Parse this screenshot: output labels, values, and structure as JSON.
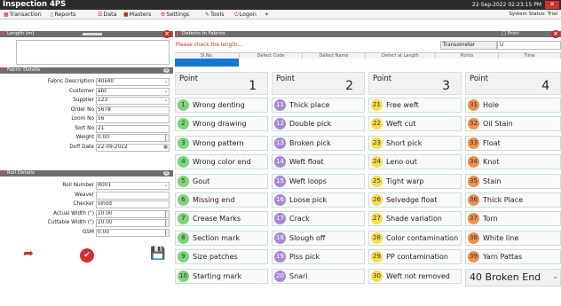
{
  "app": {
    "title": "Inspection 4PS",
    "datetime": "22-Sep-2022 02:23:15 PM",
    "system_status": "System Status: Trial"
  },
  "menu": [
    {
      "icon": "▦",
      "label": "Transaction",
      "color": "#c62828"
    },
    {
      "icon": "▯",
      "label": "Reports",
      "color": "#666"
    },
    {
      "icon": "☰",
      "label": "Data",
      "color": "#c62828"
    },
    {
      "icon": "■",
      "label": "Masters",
      "color": "#c62828"
    },
    {
      "icon": "⚙",
      "label": "Settings",
      "color": "#c62828"
    },
    {
      "icon": "✎",
      "label": "Tools",
      "color": "#555"
    },
    {
      "icon": "⏻",
      "label": "Logon",
      "color": "#c62828"
    },
    {
      "icon": "✦",
      "label": "",
      "color": "#c62828"
    }
  ],
  "panels": {
    "length": "Length (m)",
    "fabric": "Fabric Details",
    "roll": "Roll Details",
    "defects": "Defects In Fabrics"
  },
  "fabric_fields": [
    {
      "label": "Fabric Description",
      "value": "40x40",
      "type": "dd"
    },
    {
      "label": "Customer",
      "value": "abc",
      "type": "dd"
    },
    {
      "label": "Supplier",
      "value": "123",
      "type": "dd"
    },
    {
      "label": "Order No",
      "value": "5678",
      "type": "text"
    },
    {
      "label": "Loom No",
      "value": "56",
      "type": "text"
    },
    {
      "label": "Sort No",
      "value": "21",
      "type": "text"
    },
    {
      "label": "Weight",
      "value": "0.00",
      "type": "spin"
    },
    {
      "label": "Doff Date",
      "value": "22-09-2022",
      "type": "cal"
    }
  ],
  "roll_fields": [
    {
      "label": "Roll Number",
      "value": "R001",
      "type": "dd"
    },
    {
      "label": "Weaver",
      "value": "",
      "type": "text"
    },
    {
      "label": "Checker",
      "value": "vinod",
      "type": "text"
    },
    {
      "label": "Actual Width (\")",
      "value": "10.00",
      "type": "spin"
    },
    {
      "label": "Cuttable Width (\")",
      "value": "10.00",
      "type": "spin"
    },
    {
      "label": "GSM",
      "value": "0.00",
      "type": "spin"
    }
  ],
  "defects": {
    "warning": "Please check the length...",
    "transometer_label": "Transometer",
    "transometer_value": "U",
    "print_label": "Print",
    "columns": [
      "Sl.No.",
      "Defect Code",
      "Defect Name",
      "Defect at Length",
      "Points",
      "Time"
    ]
  },
  "groups": [
    {
      "label": "Point",
      "number": "1",
      "cls": "g",
      "items": [
        {
          "n": "1",
          "t": "Wrong denting"
        },
        {
          "n": "2",
          "t": "Wrong drawing"
        },
        {
          "n": "3",
          "t": "Wrong pattern"
        },
        {
          "n": "4",
          "t": "Wrong color end"
        },
        {
          "n": "5",
          "t": "Gout"
        },
        {
          "n": "6",
          "t": "Missing end"
        },
        {
          "n": "7",
          "t": "Crease Marks"
        },
        {
          "n": "8",
          "t": "Section mark"
        },
        {
          "n": "9",
          "t": "Size patches"
        },
        {
          "n": "10",
          "t": "Starting mark"
        }
      ]
    },
    {
      "label": "Point",
      "number": "2",
      "cls": "p",
      "items": [
        {
          "n": "11",
          "t": "Thick place"
        },
        {
          "n": "12",
          "t": "Double pick"
        },
        {
          "n": "13",
          "t": "Broken pick"
        },
        {
          "n": "14",
          "t": "Weft float"
        },
        {
          "n": "15",
          "t": "Weft loops"
        },
        {
          "n": "16",
          "t": "Loose pick"
        },
        {
          "n": "17",
          "t": "Crack"
        },
        {
          "n": "18",
          "t": "Slough off"
        },
        {
          "n": "19",
          "t": "Piss pick"
        },
        {
          "n": "20",
          "t": "Snari"
        }
      ]
    },
    {
      "label": "Point",
      "number": "3",
      "cls": "y",
      "items": [
        {
          "n": "21",
          "t": "Free weft"
        },
        {
          "n": "22",
          "t": "Weft cut"
        },
        {
          "n": "23",
          "t": "Short pick"
        },
        {
          "n": "24",
          "t": "Leno out"
        },
        {
          "n": "25",
          "t": "Tight warp"
        },
        {
          "n": "26",
          "t": "Selvedge float"
        },
        {
          "n": "27",
          "t": "Shade variation"
        },
        {
          "n": "28",
          "t": "Color contamination"
        },
        {
          "n": "29",
          "t": "PP contamination"
        },
        {
          "n": "30",
          "t": "Weft not removed"
        }
      ]
    },
    {
      "label": "Point",
      "number": "4",
      "cls": "o",
      "items": [
        {
          "n": "31",
          "t": "Hole"
        },
        {
          "n": "32",
          "t": "Oil Stain"
        },
        {
          "n": "33",
          "t": "Float"
        },
        {
          "n": "34",
          "t": "Knot"
        },
        {
          "n": "35",
          "t": "Stain"
        },
        {
          "n": "36",
          "t": "Thick Place"
        },
        {
          "n": "37",
          "t": "Torn"
        },
        {
          "n": "38",
          "t": "White line"
        },
        {
          "n": "39",
          "t": "Yarn Pattas"
        }
      ]
    }
  ],
  "broken_end": "40 Broken End"
}
